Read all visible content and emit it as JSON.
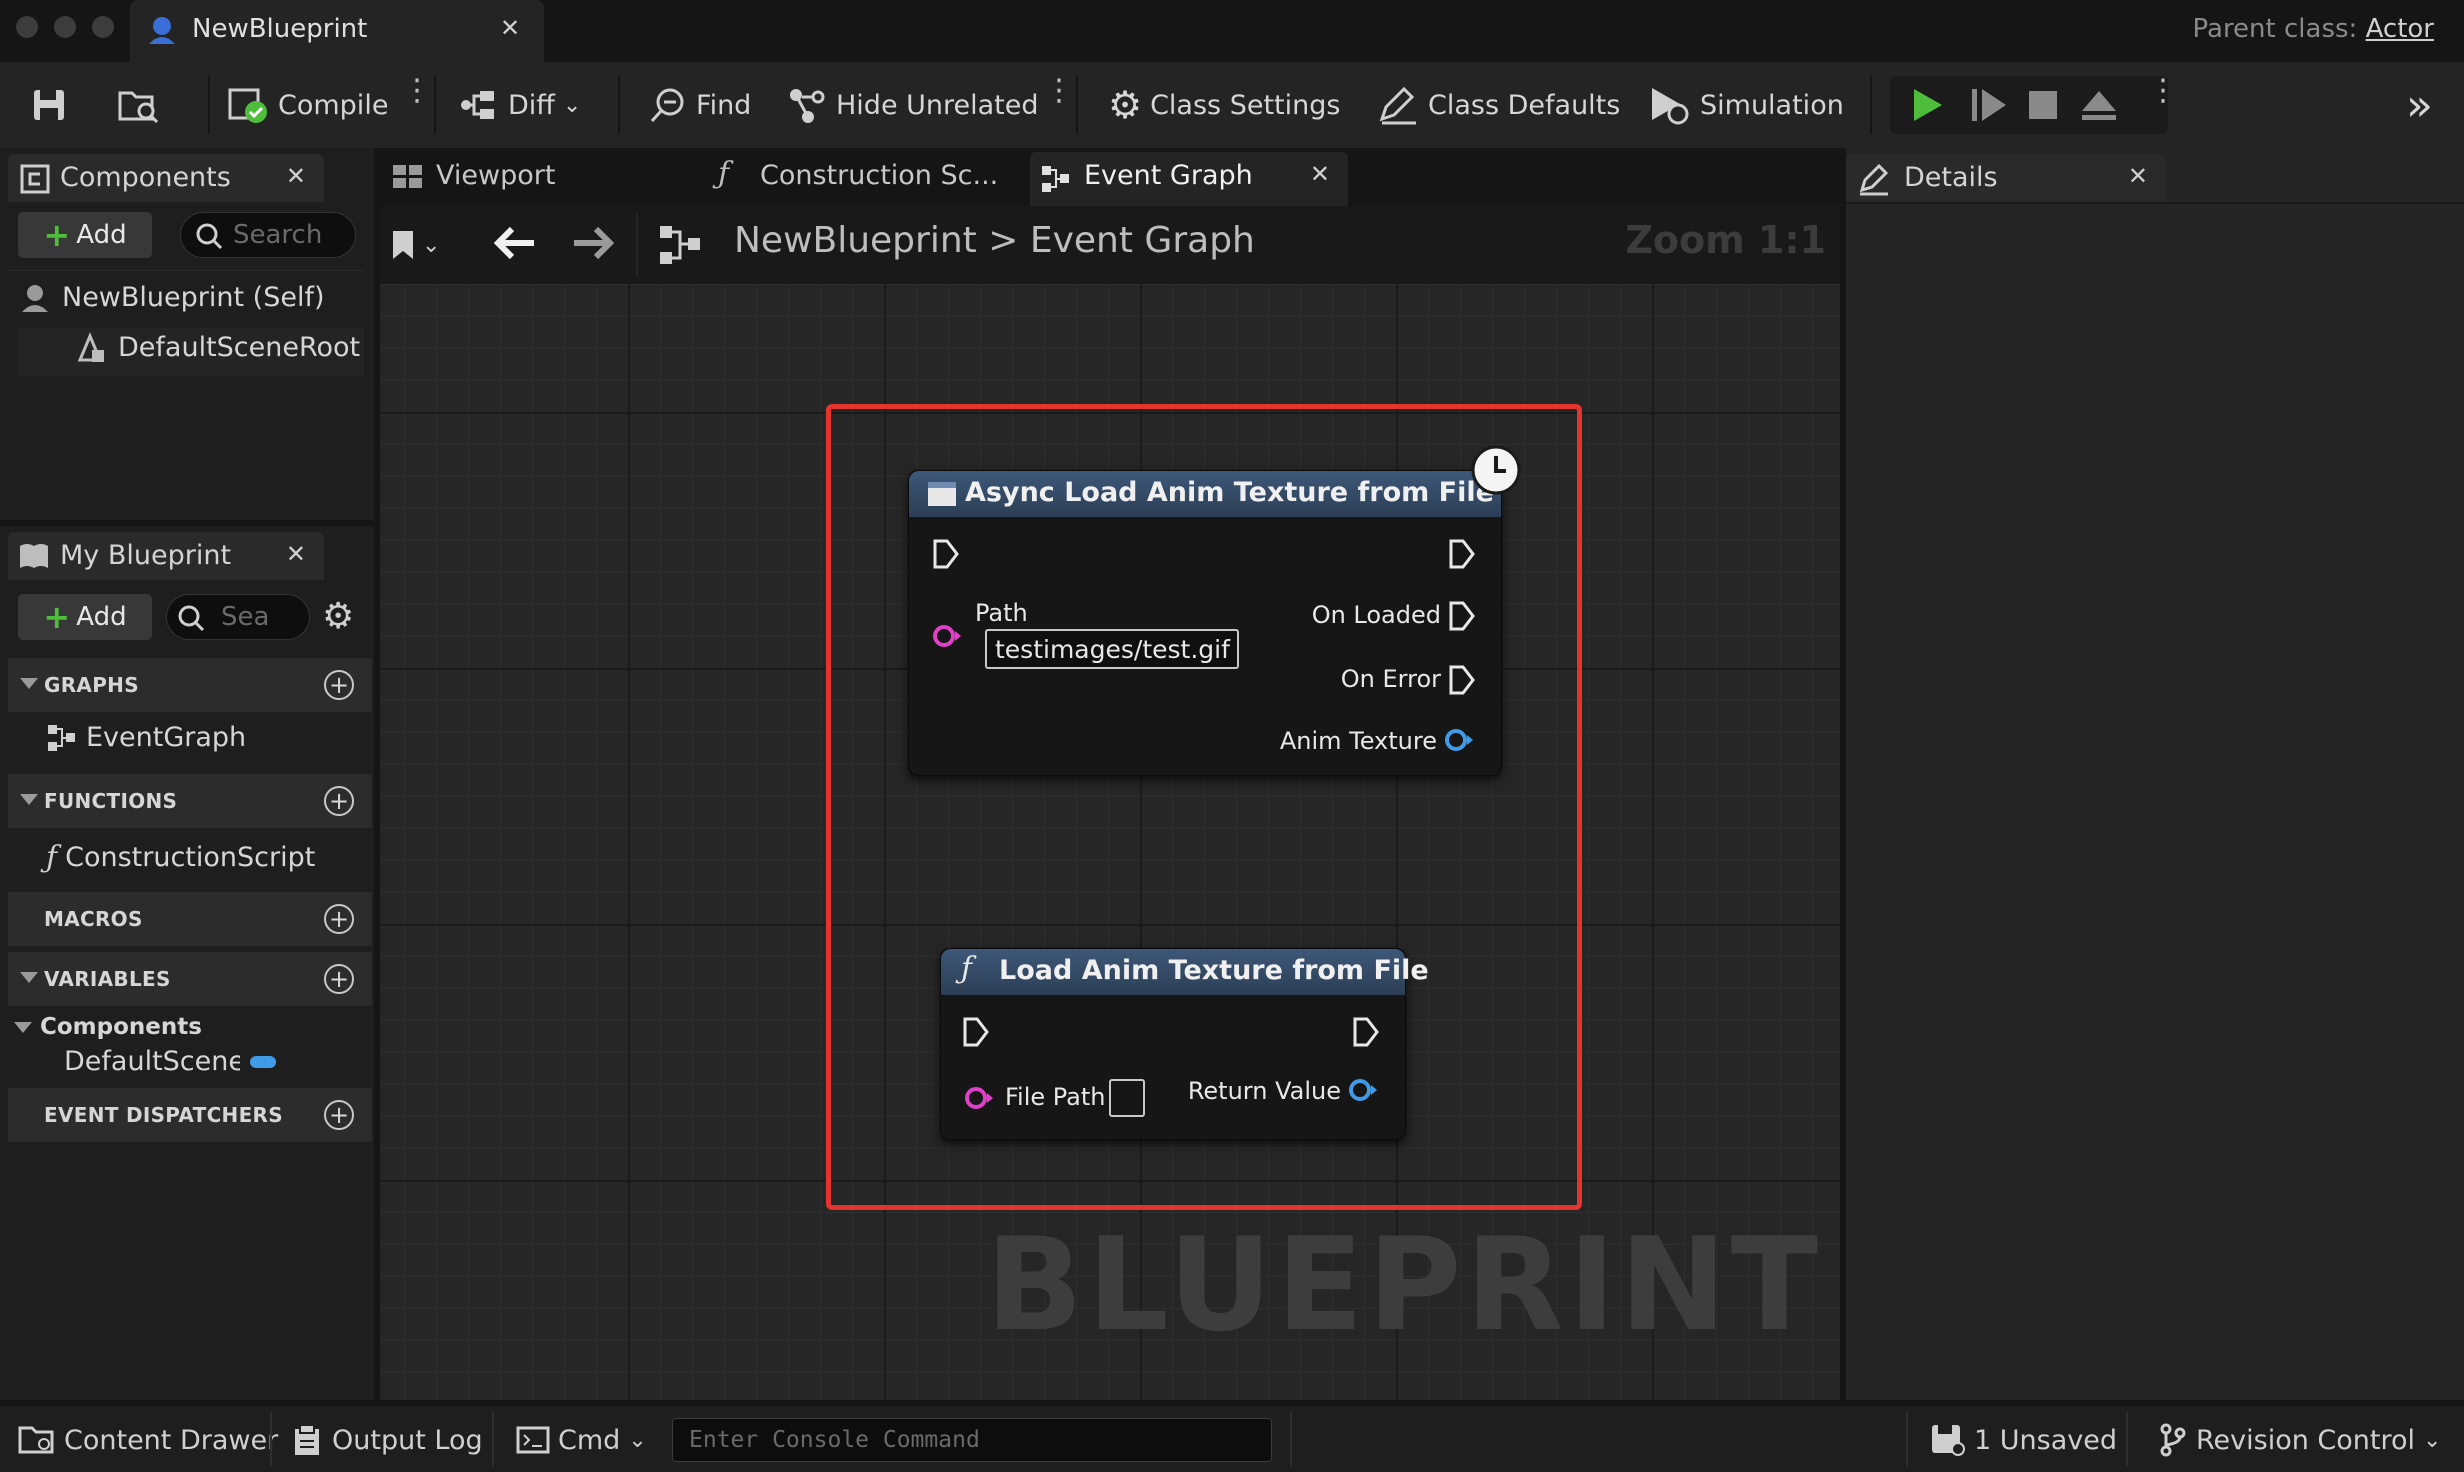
{
  "window": {
    "doc_tab": "NewBlueprint",
    "parent_class_label": "Parent class:",
    "parent_class_value": "Actor"
  },
  "toolbar": {
    "compile": "Compile",
    "diff": "Diff",
    "find": "Find",
    "hide_unrelated": "Hide Unrelated",
    "class_settings": "Class Settings",
    "class_defaults": "Class Defaults",
    "simulation": "Simulation"
  },
  "components_panel": {
    "tab": "Components",
    "add": "Add",
    "search_placeholder": "Search",
    "tree": [
      {
        "label": "NewBlueprint (Self)"
      },
      {
        "label": "DefaultSceneRoot"
      }
    ]
  },
  "my_blueprint": {
    "tab": "My Blueprint",
    "add": "Add",
    "search_placeholder": "Sea",
    "sections": {
      "graphs": "GRAPHS",
      "functions": "FUNCTIONS",
      "macros": "MACROS",
      "variables": "VARIABLES",
      "event_dispatchers": "EVENT DISPATCHERS"
    },
    "graph_items": [
      "EventGraph"
    ],
    "function_items": [
      "ConstructionScript"
    ],
    "variable_category": "Components",
    "variable_items": [
      "DefaultSceneF"
    ]
  },
  "editor_tabs": [
    "Viewport",
    "Construction Sc...",
    "Event Graph"
  ],
  "graph": {
    "breadcrumb_root": "NewBlueprint",
    "breadcrumb_sep": ">",
    "breadcrumb_current": "Event Graph",
    "zoom": "Zoom 1:1",
    "watermark": "BLUEPRINT"
  },
  "nodes": {
    "async": {
      "title": "Async Load Anim Texture from File",
      "path_label": "Path",
      "path_value": "testimages/test.gif",
      "on_loaded": "On Loaded",
      "on_error": "On Error",
      "anim_texture": "Anim Texture"
    },
    "sync": {
      "title": "Load Anim Texture from File",
      "file_path": "File Path",
      "return_value": "Return Value"
    }
  },
  "details": {
    "tab": "Details"
  },
  "bottom": {
    "content_drawer": "Content Drawer",
    "output_log": "Output Log",
    "cmd": "Cmd",
    "console_placeholder": "Enter Console Command",
    "unsaved": "1 Unsaved",
    "revision_control": "Revision Control"
  },
  "colors": {
    "highlight": "#e5342b",
    "play": "#4fbd3c",
    "object_pin": "#3f9be8",
    "string_pin": "#e040c8",
    "node_header": "#3d5878"
  }
}
